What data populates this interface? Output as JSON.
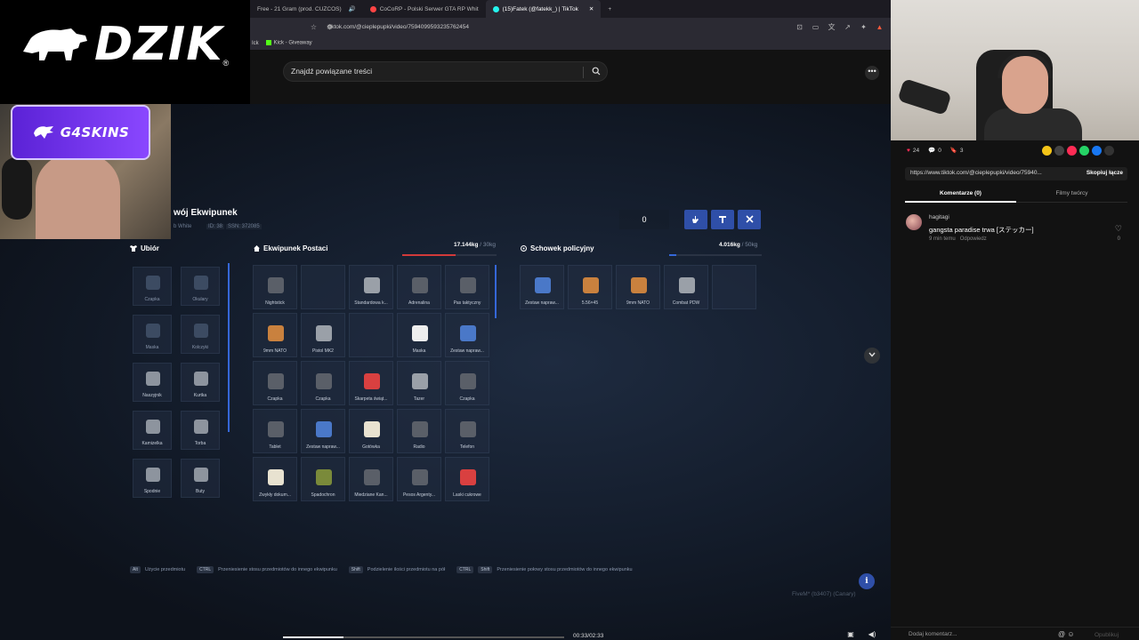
{
  "overlay": {
    "brand": "DZIK",
    "reg": "®",
    "sponsor": "G4SKINS"
  },
  "browser": {
    "tabs": [
      {
        "label": "Free - 21 Gram (prod. CUZCOS)",
        "color": "#ff5555"
      },
      {
        "label": "CoCoRP - Polski Serwer GTA RP Whit",
        "color": "#ff4444"
      },
      {
        "label": "(15)Fatek (@fatekk_) | TikTok",
        "color": "#25f4ee",
        "active": true
      }
    ],
    "url": "tiktok.com/@cieplepupki/video/7594099593235762454",
    "bookmarks": [
      "Ick",
      "Kick - Giveaway"
    ]
  },
  "tiktok": {
    "search_placeholder": "Znajdź powiązane treści",
    "time": "00:33/02:33",
    "progress_pct": 21.5,
    "likes": "24",
    "comments": "0",
    "saves": "3",
    "link": "https://www.tiktok.com/@cieplepupki/video/75940...",
    "copy_link": "Skopiuj łącze",
    "tab_comments": "Komentarze (0)",
    "tab_creator": "Filmy twórcy",
    "comment": {
      "user": "hagitagi",
      "text": "gangsta paradise trwa [ステッカー]",
      "time": "9 min temu",
      "reply": "Odpowiedz",
      "likes": "0"
    },
    "add_comment": "Dodaj komentarz...",
    "post": "Opublikuj"
  },
  "game": {
    "title": "wój Ekwipunek",
    "subtitle": "b White",
    "subtitle_tags": [
      "ID: 38",
      "SSN: 372085"
    ],
    "clothing_title": "Ubiór",
    "character_title": "Ekwipunek Postaci",
    "character_weight": "17.144kg",
    "character_max": "/ 30kg",
    "police_title": "Schowek policyjny",
    "police_weight": "4.016kg",
    "police_max": "/ 50kg",
    "amount": "0",
    "clothing": [
      [
        "Czapka",
        "Okulary"
      ],
      [
        "Maska",
        "Kolczyki"
      ],
      [
        "Naszyjnik",
        "Kurtka"
      ],
      [
        "Kamizelka",
        "Torba"
      ],
      [
        "Spodnie",
        "Buty"
      ]
    ],
    "character_items": [
      [
        "Nightstick",
        "",
        "Standardowa k...",
        "Adrenalina",
        "Pas taktyczny"
      ],
      [
        "9mm NATO",
        "Pistol MK2",
        "",
        "Maska",
        "Zestaw napraw..."
      ],
      [
        "Czapka",
        "Czapka",
        "Skarpeta świąt...",
        "Tazer",
        "Czapka"
      ],
      [
        "Tablet",
        "Zestaw napraw...",
        "Gotówka",
        "Radio",
        "Telefon"
      ],
      [
        "Zwykły dokum...",
        "Spadochron",
        "Miedziane Kan...",
        "Pesos Argenty...",
        "Laski cukrowe"
      ]
    ],
    "police_items": [
      "Zestaw napraw...",
      "5.56×45",
      "9mm NATO",
      "Combat PDW"
    ],
    "hints": [
      {
        "keys": [
          "Alt"
        ],
        "text": "Użycie przedmiotu"
      },
      {
        "keys": [
          "CTRL"
        ],
        "text": "Przeniesienie stosu przedmiotów do innego ekwipunku"
      },
      {
        "keys": [
          "Shift"
        ],
        "text": "Podzielenie ilości przedmiotu na pół"
      },
      {
        "keys": [
          "CTRL",
          "Shift"
        ],
        "text": "Przeniesienie połowy stosu przedmiotów do innego ekwipunku"
      }
    ],
    "fivem": "FiveM* (b3407) (Canary)"
  }
}
